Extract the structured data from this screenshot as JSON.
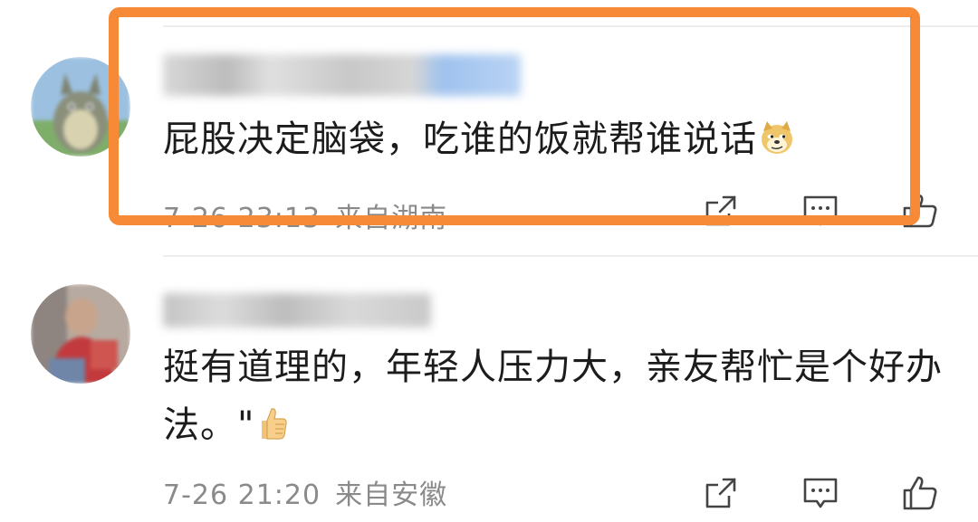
{
  "comments": [
    {
      "username": "",
      "text": "屁股决定脑袋，吃谁的饭就帮谁说话",
      "emoji": "doge-emoji",
      "time": "7-26 23:13",
      "location": "来自湖南",
      "highlighted": true
    },
    {
      "username": "",
      "text": "挺有道理的，年轻人压力大，亲友帮忙是个好办法。\"",
      "emoji": "thumbs-up-emoji",
      "time": "7-26 21:20",
      "location": "来自安徽",
      "highlighted": false
    }
  ],
  "actions": {
    "share_icon": "share-icon",
    "reply_icon": "comment-icon",
    "like_icon": "thumbs-up-icon"
  },
  "colors": {
    "highlight": "#f68a36",
    "meta_text": "#8a8a8a",
    "divider": "#ededed"
  }
}
